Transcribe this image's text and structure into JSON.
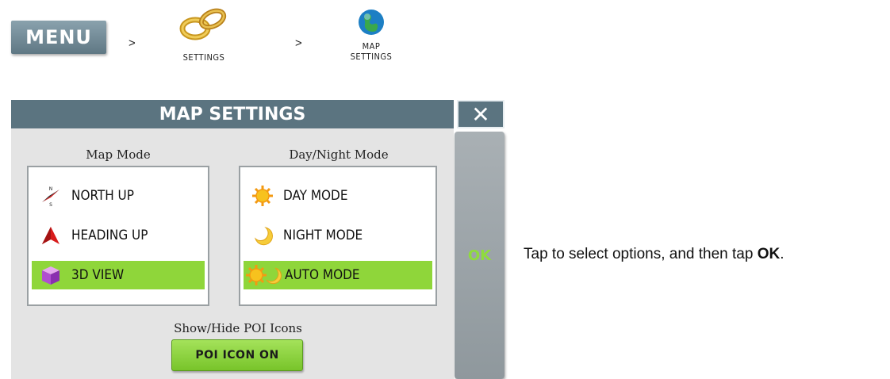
{
  "breadcrumb": {
    "menu_label": "MENU",
    "separator": ">",
    "settings_label": "SETTINGS",
    "map_settings_label_line1": "MAP",
    "map_settings_label_line2": "SETTINGS"
  },
  "dialog": {
    "title": "MAP SETTINGS",
    "close_glyph": "✕",
    "ok_label": "OK",
    "map_mode": {
      "heading": "Map Mode",
      "options": [
        {
          "label": "NORTH UP",
          "icon": "compass-icon",
          "selected": false
        },
        {
          "label": "HEADING UP",
          "icon": "arrow-icon",
          "selected": false
        },
        {
          "label": "3D VIEW",
          "icon": "cube-icon",
          "selected": true
        }
      ]
    },
    "day_night_mode": {
      "heading": "Day/Night Mode",
      "options": [
        {
          "label": "DAY MODE",
          "icon": "sun-icon",
          "selected": false
        },
        {
          "label": "NIGHT MODE",
          "icon": "moon-icon",
          "selected": false
        },
        {
          "label": "AUTO MODE",
          "icon": "sun-moon-icon",
          "selected": true
        }
      ]
    },
    "poi": {
      "heading": "Show/Hide POI Icons",
      "button_label": "POI ICON ON"
    }
  },
  "hint": {
    "text": "Tap to select options, and then tap ",
    "bold": "OK",
    "end": "."
  },
  "colors": {
    "title_bar": "#5b7480",
    "selected": "#8fd63a",
    "ok_text": "#8fdc3c"
  }
}
